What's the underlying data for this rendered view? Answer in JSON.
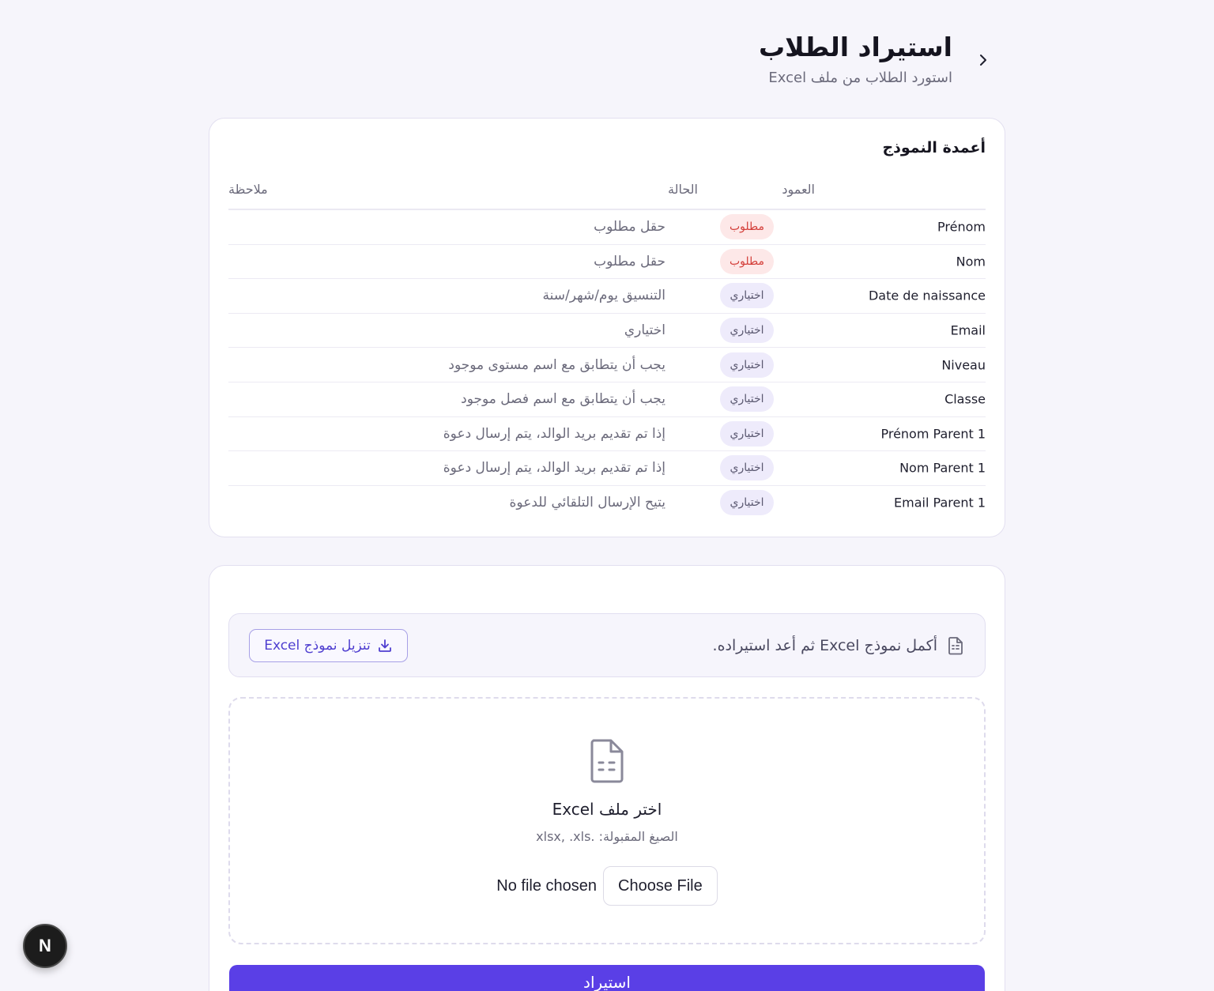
{
  "header": {
    "title": "استيراد الطلاب",
    "subtitle": "استورد الطلاب من ملف Excel",
    "back_icon": "chevron-right-icon"
  },
  "columns_card": {
    "title": "أعمدة النموذج",
    "headers": {
      "column": "العمود",
      "status": "الحالة",
      "note": "ملاحظة"
    },
    "rows": [
      {
        "name": "Prénom",
        "status": "مطلوب",
        "status_type": "required",
        "note": "حقل مطلوب"
      },
      {
        "name": "Nom",
        "status": "مطلوب",
        "status_type": "required",
        "note": "حقل مطلوب"
      },
      {
        "name": "Date de naissance",
        "status": "اختياري",
        "status_type": "optional",
        "note": "التنسيق يوم/شهر/سنة"
      },
      {
        "name": "Email",
        "status": "اختياري",
        "status_type": "optional",
        "note": "اختياري"
      },
      {
        "name": "Niveau",
        "status": "اختياري",
        "status_type": "optional",
        "note": "يجب أن يتطابق مع اسم مستوى موجود"
      },
      {
        "name": "Classe",
        "status": "اختياري",
        "status_type": "optional",
        "note": "يجب أن يتطابق مع اسم فصل موجود"
      },
      {
        "name": "Prénom Parent 1",
        "status": "اختياري",
        "status_type": "optional",
        "note": "إذا تم تقديم بريد الوالد، يتم إرسال دعوة"
      },
      {
        "name": "Nom Parent 1",
        "status": "اختياري",
        "status_type": "optional",
        "note": "إذا تم تقديم بريد الوالد، يتم إرسال دعوة"
      },
      {
        "name": "Email Parent 1",
        "status": "اختياري",
        "status_type": "optional",
        "note": "يتيح الإرسال التلقائي للدعوة"
      }
    ]
  },
  "upload_card": {
    "banner_text": "أكمل نموذج Excel ثم أعد استيراده.",
    "download_label": "تنزيل نموذج Excel",
    "dropzone_title": "اختر ملف Excel",
    "dropzone_subtitle": "الصيغ المقبولة: .xlsx, .xls",
    "choose_file_label": "Choose File",
    "file_status": "No file chosen",
    "import_label": "استيراد"
  },
  "dev_badge": {
    "label": "N"
  },
  "colors": {
    "primary": "#5a3fe6",
    "required_bg": "#fde8e8",
    "required_text": "#d43f3a",
    "optional_bg": "#eeebfb"
  }
}
